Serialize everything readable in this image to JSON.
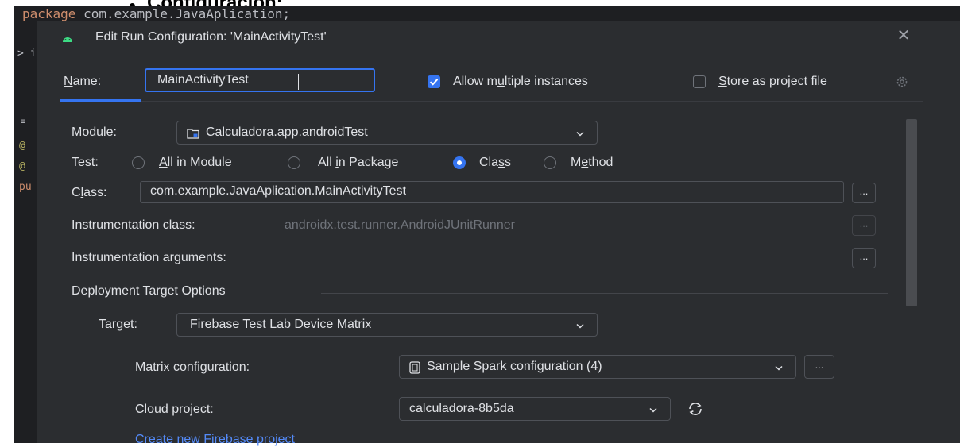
{
  "document": {
    "heading": "Configuración:"
  },
  "editor": {
    "code_line_keyword": "package",
    "code_line_name": " com.example.JavaAplication;",
    "gutter": [
      "> im",
      "≠",
      "@",
      "@",
      "pu"
    ]
  },
  "dialog": {
    "title": "Edit Run Configuration: 'MainActivityTest'",
    "name_label": "Name:",
    "name_value": "MainActivityTest",
    "allow_multiple": {
      "label": "Allow multiple instances",
      "checked": true
    },
    "store_as_project": {
      "label": "Store as project file",
      "checked": false
    },
    "module": {
      "label": "Module:",
      "value": "Calculadora.app.androidTest"
    },
    "test": {
      "label": "Test:",
      "options": [
        {
          "label": "All in Module",
          "selected": false
        },
        {
          "label": "All in Package",
          "selected": false
        },
        {
          "label": "Class",
          "selected": true
        },
        {
          "label": "Method",
          "selected": false
        }
      ]
    },
    "class": {
      "label": "Class:",
      "value": "com.example.JavaAplication.MainActivityTest",
      "button": "..."
    },
    "instrumentation_class": {
      "label": "Instrumentation class:",
      "value": "androidx.test.runner.AndroidJUnitRunner",
      "button": "..."
    },
    "instrumentation_args": {
      "label": "Instrumentation arguments:",
      "button": "..."
    },
    "deployment_section": "Deployment Target Options",
    "target": {
      "label": "Target:",
      "value": "Firebase Test Lab Device Matrix"
    },
    "matrix": {
      "label": "Matrix configuration:",
      "value": "Sample Spark configuration (4)",
      "button": "..."
    },
    "cloud_project": {
      "label": "Cloud project:",
      "value": "calculadora-8b5da"
    },
    "create_link": "Create new Firebase project"
  },
  "colors": {
    "accent": "#3574f0",
    "dialog_bg": "#2b2d30",
    "editor_bg": "#1e1f22",
    "text": "#dfe1e5",
    "link": "#548af7"
  }
}
